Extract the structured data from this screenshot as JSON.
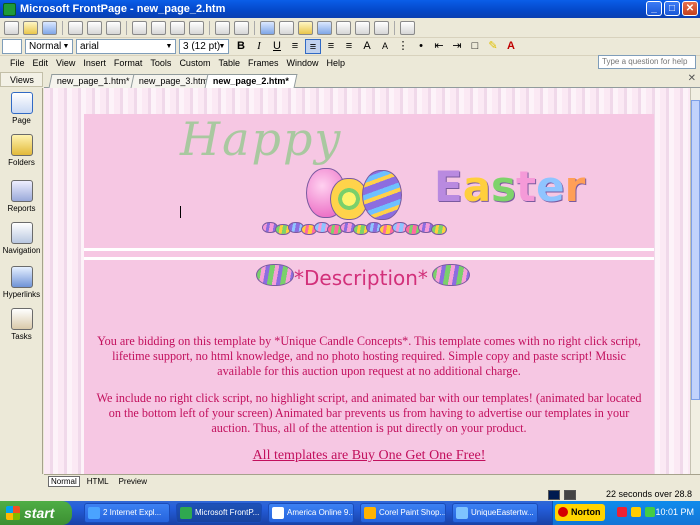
{
  "window": {
    "title": "Microsoft FrontPage - new_page_2.htm",
    "min": "_",
    "max": "□",
    "close": "✕"
  },
  "format_toolbar": {
    "style": "Normal",
    "font": "arial",
    "size": "3  (12 pt)"
  },
  "menu": [
    "File",
    "Edit",
    "View",
    "Insert",
    "Format",
    "Tools",
    "Custom",
    "Table",
    "Frames",
    "Window",
    "Help"
  ],
  "help_placeholder": "Type a question for help",
  "views": {
    "header": "Views",
    "items": [
      "Page",
      "Folders",
      "Reports",
      "Navigation",
      "Hyperlinks",
      "Tasks"
    ]
  },
  "tabs": [
    "new_page_1.htm*",
    "new_page_3.htm*",
    "new_page_2.htm*"
  ],
  "page": {
    "heading": "*Description*",
    "paragraph1": "You are bidding on this template by *Unique Candle Concepts*. This template comes with no right click script, lifetime support, no html knowledge, and no photo hosting required. Simple copy and paste script! Music available for this auction upon request at no additional charge.",
    "paragraph2": "We include no right click script, no highlight script, and animated bar with our templates! (animated bar located on the bottom left of your screen) Animated bar prevents us from having to advertise our templates in your auction. Thus, all of the attention is put directly on your product.",
    "footer_link": "All templates are Buy One Get One Free!",
    "banner_word_1": "Happy",
    "banner_word_2": "Easter",
    "colors": {
      "text": "#c2105d",
      "background": "#f6c7e3"
    }
  },
  "modes": [
    "Normal",
    "HTML",
    "Preview"
  ],
  "status": {
    "download": "22 seconds over 28.8"
  },
  "taskbar": {
    "start": "start",
    "tasks": [
      "2 Internet Expl...",
      "Microsoft FrontP...",
      "America Online 9...",
      "Corel Paint Shop...",
      "UniqueEastertw..."
    ],
    "norton": "Norton",
    "clock": "10:01 PM"
  }
}
